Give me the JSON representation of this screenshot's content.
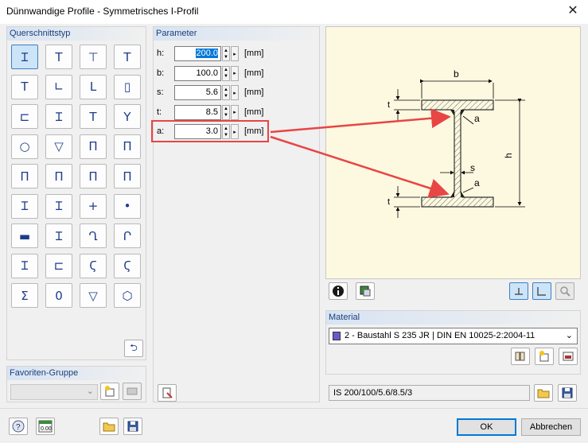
{
  "window": {
    "title": "Dünnwandige Profile - Symmetrisches I-Profil",
    "close_glyph": "✕"
  },
  "cross_section_type": {
    "title": "Querschnittstyp",
    "selected_index": 0,
    "rows": [
      [
        "Ɪ",
        "T",
        "⊤",
        "T"
      ],
      [
        "T",
        "∟",
        "L",
        "▯"
      ],
      [
        "⊏",
        "Ɪ",
        "T",
        "Y"
      ],
      [
        "○",
        "▽",
        "Π",
        "Π"
      ],
      [
        "Π",
        "Π",
        "Π",
        "Π"
      ],
      [
        "Ɪ",
        "Ɪ",
        "+",
        "•"
      ],
      [
        "▬",
        "Ɪ",
        "Ղ",
        "Ր"
      ],
      [
        "Ɪ",
        "⊏",
        "Ϛ",
        "Ϛ"
      ],
      [
        "Σ",
        "0",
        "▽",
        "⬡"
      ]
    ],
    "undo_glyph": "⮌"
  },
  "favorites": {
    "title": "Favoriten-Gruppe",
    "selected": "",
    "dropdown_arrow": "⌄"
  },
  "parameters": {
    "title": "Parameter",
    "rows": [
      {
        "label": "h:",
        "value": "200.0",
        "unit": "[mm]"
      },
      {
        "label": "b:",
        "value": "100.0",
        "unit": "[mm]"
      },
      {
        "label": "s:",
        "value": "5.6",
        "unit": "[mm]"
      },
      {
        "label": "t:",
        "value": "8.5",
        "unit": "[mm]"
      },
      {
        "label": "a:",
        "value": "3.0",
        "unit": "[mm]"
      }
    ],
    "spin_up": "▲",
    "spin_down": "▼",
    "spin_right": "▸"
  },
  "diagram": {
    "labels": {
      "b": "b",
      "h": "h",
      "t_top": "t",
      "t_bottom": "t",
      "s": "s",
      "a_top": "a",
      "a_bottom": "a"
    },
    "highlight_color": "#e84545",
    "background": "#fdf9e0"
  },
  "material": {
    "title": "Material",
    "color": "#6a5acd",
    "selected": "2 - Baustahl S 235 JR | DIN EN 10025-2:2004-11",
    "dropdown_arrow": "⌄"
  },
  "section_name": "IS 200/100/5.6/8.5/3",
  "buttons": {
    "ok": "OK",
    "cancel": "Abbrechen"
  }
}
